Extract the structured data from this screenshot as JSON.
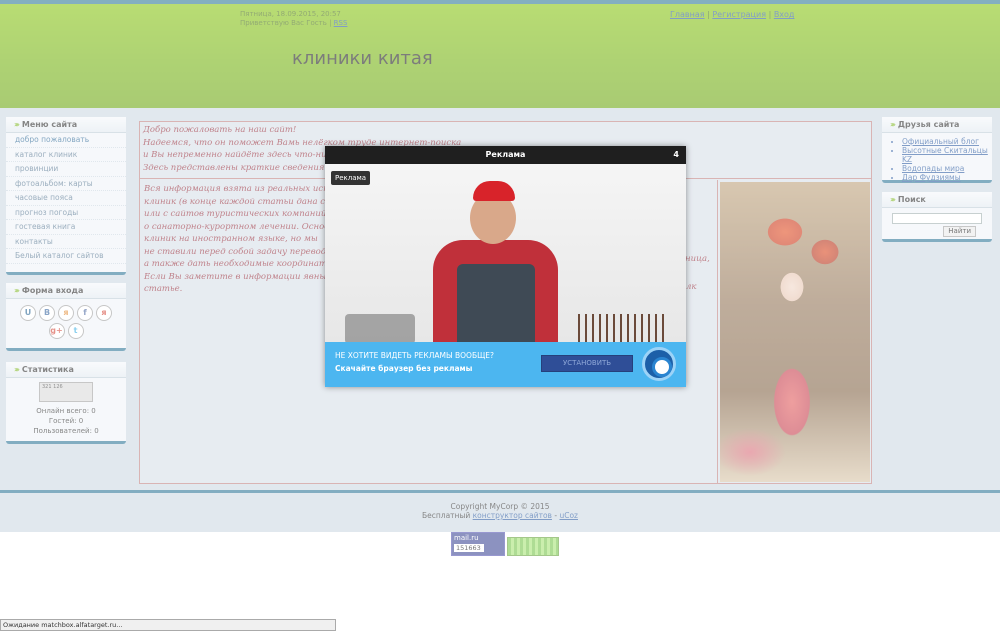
{
  "header": {
    "date_line": "Пятница, 18.09.2015, 20:57",
    "greeting_prefix": "Приветствую Вас Гость |",
    "rss": "RSS",
    "nav": {
      "home": "Главная",
      "sep1": "|",
      "register": "Регистрация",
      "sep2": "|",
      "login": "Вход"
    },
    "site_title": "клиники китая"
  },
  "left": {
    "menu_title": "Меню сайта",
    "menu_items": [
      "добро пожаловать",
      "каталог клиник",
      "провинции",
      "фотоальбом: карты",
      "часовые пояса",
      "прогноз погоды",
      "гостевая книга",
      "контакты",
      "Белый каталог сайтов"
    ],
    "login_title": "Форма входа",
    "social": [
      "U",
      "B",
      "я",
      "f",
      "я",
      "g+",
      "t"
    ],
    "stats_title": "Статистика",
    "online_total": "Онлайн всего: 0",
    "guests": "Гостей: 0",
    "users": "Пользователей: 0",
    "counter_value": "321 126"
  },
  "right": {
    "friends_title": "Друзья сайта",
    "friends": [
      "Официальный блог",
      "Высотные Скитальцы KZ",
      "Водопады мира",
      "Дар Фудзиямы"
    ],
    "search_title": "Поиск",
    "search_button": "Найти"
  },
  "content": {
    "welcome_lines": [
      "Добро пожаловать на наш сайт!",
      "Надеемся, что он поможет Вамь нелёгком труде интернет-поиска",
      "и Вы непременно найдёте здесь что-нибуд",
      " Здесь представлены краткие сведения о л"
    ],
    "article_lines": [
      " Вся информация взята из реальных исто",
      "клиник (в конце каждой статьи дана ссыл",
      "или с сайтов туристических компаний -к",
      "о санаторно-курортном лечении. Основна",
      "клиник на иностранном языке, но мы",
      "не ставили перед собой задачу переводить",
      "а также дать необходимые координаты.",
      "Если Вы заметите в информации явные о",
      "статье."
    ],
    "article_right_fragments": [
      "льница,",
      "лк"
    ]
  },
  "footer": {
    "copyright": "Copyright MyCorp © 2015",
    "free_prefix": "Бесплатный",
    "builder_link": "конструктор сайтов",
    "dash": "-",
    "ucoz": "uCoz",
    "mailru_label": "mail.ru",
    "mailru_count": "151663"
  },
  "status_bar": "Ожидание matchbox.alfatarget.ru...",
  "modal": {
    "title": "Реклама",
    "countdown": "4",
    "ad_tag": "Реклама",
    "banner_line1": "НЕ ХОТИТЕ ВИДЕТЬ РЕКЛАМЫ ВООБЩЕ?",
    "banner_line2": "Скачайте браузер без рекламы",
    "banner_button": "УСТАНОВИТЬ"
  }
}
